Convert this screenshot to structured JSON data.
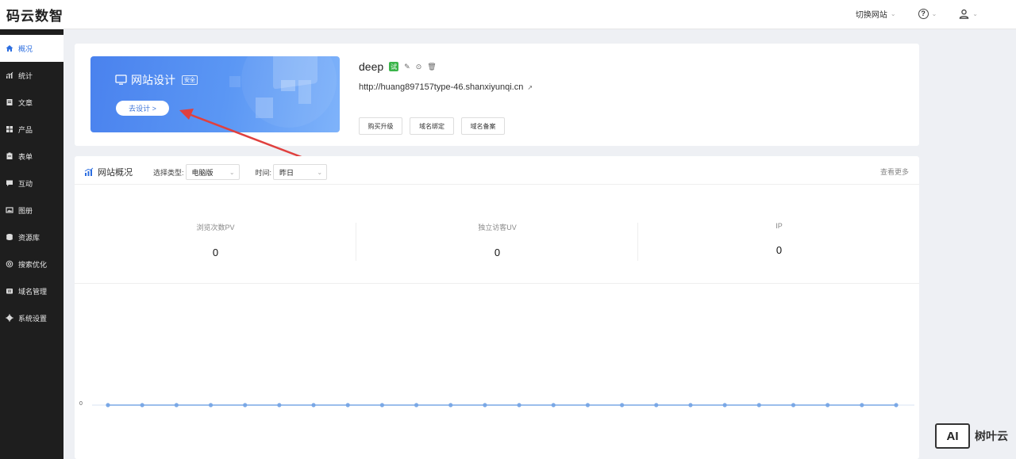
{
  "header": {
    "brand": "码云数智",
    "switch_site": "切换网站",
    "help_icon": "question-circle-icon",
    "user_icon": "user-icon"
  },
  "sidebar": {
    "items": [
      {
        "label": "概况",
        "icon": "home-icon",
        "active": true
      },
      {
        "label": "统计",
        "icon": "chart-icon"
      },
      {
        "label": "文章",
        "icon": "document-icon"
      },
      {
        "label": "产品",
        "icon": "grid-icon"
      },
      {
        "label": "表单",
        "icon": "clipboard-icon"
      },
      {
        "label": "互动",
        "icon": "message-icon"
      },
      {
        "label": "图册",
        "icon": "image-icon"
      },
      {
        "label": "资源库",
        "icon": "database-icon"
      },
      {
        "label": "搜索优化",
        "icon": "seo-icon"
      },
      {
        "label": "域名管理",
        "icon": "domain-icon"
      },
      {
        "label": "系统设置",
        "icon": "gear-icon"
      }
    ]
  },
  "banner": {
    "title": "网站设计",
    "badge": "安全",
    "button": "去设计 >"
  },
  "site": {
    "name": "deep",
    "trial_badge": "试",
    "url": "http://huang897157type-46.shanxiyunqi.cn",
    "actions": [
      "购买升级",
      "域名绑定",
      "域名备案"
    ]
  },
  "stats": {
    "title": "网站概况",
    "type_label": "选择类型:",
    "type_value": "电脑版",
    "time_label": "时间:",
    "time_value": "昨日",
    "view_more": "查看更多",
    "metrics": [
      {
        "label": "浏览次数PV",
        "value": "0"
      },
      {
        "label": "独立访客UV",
        "value": "0"
      },
      {
        "label": "IP",
        "value": "0"
      }
    ]
  },
  "chart_data": {
    "type": "line",
    "y_tick": "0",
    "values": [
      0,
      0,
      0,
      0,
      0,
      0,
      0,
      0,
      0,
      0,
      0,
      0,
      0,
      0,
      0,
      0,
      0,
      0,
      0,
      0,
      0,
      0,
      0,
      0
    ],
    "color": "#7aa8e6"
  },
  "watermark": {
    "logo": "AI",
    "text": "树叶云"
  }
}
